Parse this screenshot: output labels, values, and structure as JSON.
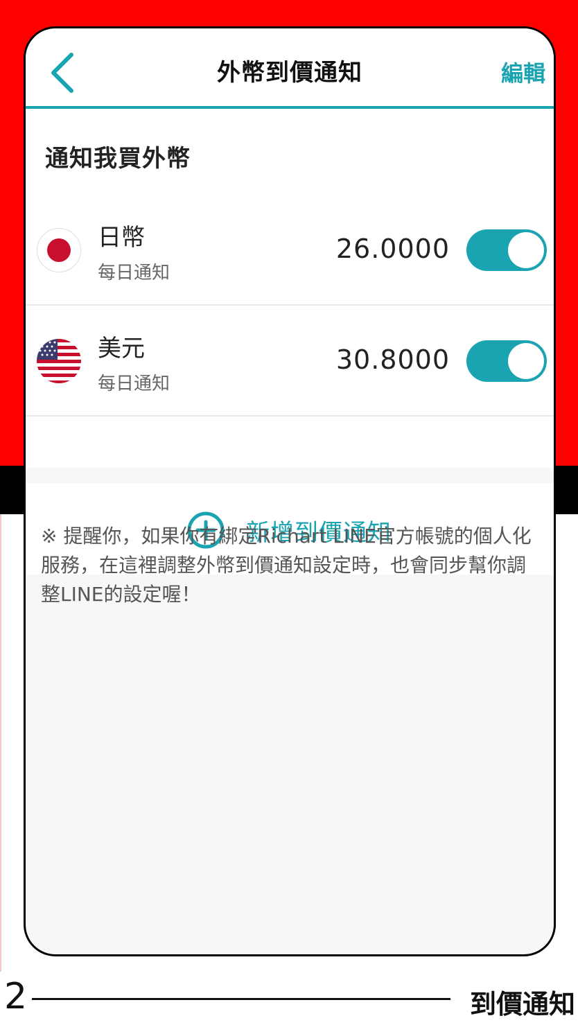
{
  "header": {
    "title": "外幣到價通知",
    "edit_label": "編輯"
  },
  "section": {
    "title": "通知我買外幣"
  },
  "alerts": [
    {
      "currency": "日幣",
      "frequency": "每日通知",
      "price": "26.0000",
      "enabled": true,
      "flag": "japan-flag"
    },
    {
      "currency": "美元",
      "frequency": "每日通知",
      "price": "30.8000",
      "enabled": true,
      "flag": "usa-flag"
    }
  ],
  "add_button": {
    "label": "新增到價通知",
    "icon": "plus-circle-icon"
  },
  "notice": {
    "text": "※ 提醒你，如果你有綁定Richart LINE官方帳號的個人化服務，在這裡調整外幣到價通知設定時，也會同步幫你調整LINE的設定喔！"
  },
  "footer": {
    "page_number": "2",
    "label": "到價通知"
  },
  "colors": {
    "accent": "#1aa3b0",
    "background_red": "#ff0000",
    "japan_red": "#c8102e"
  }
}
